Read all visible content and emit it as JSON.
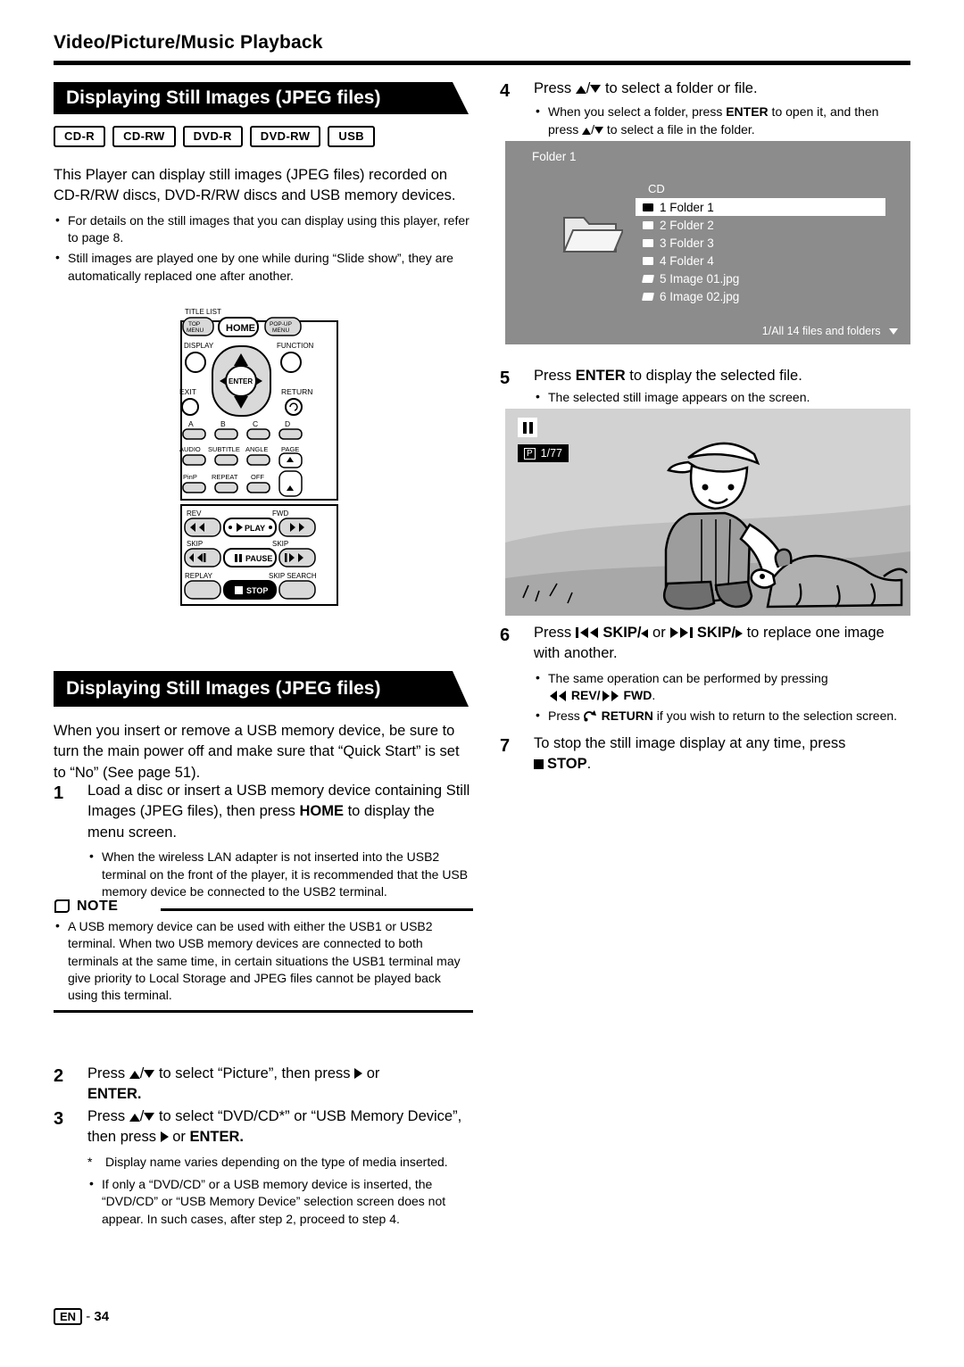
{
  "header": {
    "title": "Video/Picture/Music Playback"
  },
  "banner1": {
    "title": "Displaying Still Images (JPEG files)"
  },
  "chips": [
    "CD-R",
    "CD-RW",
    "DVD-R",
    "DVD-RW",
    "USB"
  ],
  "intro": {
    "paragraph": "This Player can display still images (JPEG files) recorded on CD-R/RW discs, DVD-R/RW discs and USB memory devices.",
    "bullets": [
      "For details on the still images that you can display using this player, refer to page 8.",
      "Still images are played one by one while during “Slide show”, they are automatically replaced one after another."
    ]
  },
  "remote": {
    "labels": {
      "title_list": "TITLE LIST",
      "top_menu": "TOP\nMENU",
      "home": "HOME",
      "popup_menu": "POP-UP\nMENU",
      "display": "DISPLAY",
      "function": "FUNCTION",
      "enter": "ENTER",
      "exit": "EXIT",
      "return": "RETURN",
      "a": "A",
      "b": "B",
      "c": "C",
      "d": "D",
      "audio": "AUDIO",
      "subtitle": "SUBTITLE",
      "angle": "ANGLE",
      "page": "PAGE",
      "pinp": "PinP",
      "repeat": "REPEAT",
      "off": "OFF",
      "rev": "REV",
      "fwd": "FWD",
      "play": "PLAY",
      "skip_l": "SKIP",
      "skip_r": "SKIP",
      "replay": "REPLAY",
      "skip_search": "SKIP SEARCH",
      "pause": "PAUSE",
      "stop": "STOP"
    }
  },
  "banner2": {
    "title": "Displaying Still Images (JPEG files)"
  },
  "usb_note": "When you insert or remove a USB memory device, be sure to turn the main power off and make sure that “Quick Start” is set to “No” (See page 51).",
  "steps_left": [
    {
      "num": "1",
      "text_parts": [
        {
          "t": "Load a disc or insert a USB memory device containing Still Images (JPEG files), then press ",
          "b": false
        },
        {
          "t": "HOME",
          "b": true
        },
        {
          "t": " to display the menu screen.",
          "b": false
        }
      ],
      "bullets": [
        "When the wireless LAN adapter is not inserted into the USB2 terminal on the front of the player, it is recommended that the USB memory device be connected to the USB2 terminal."
      ]
    }
  ],
  "note": {
    "label": "NOTE",
    "bullets": [
      "A USB memory device can be used with either the USB1 or USB2 terminal. When two USB memory devices are connected to both terminals at the same time, in certain situations the USB1 terminal may give priority to Local Storage and JPEG files cannot be played back using this terminal."
    ]
  },
  "steps_left2": [
    {
      "num": "2",
      "pre": "Press ",
      "mid": " to select “Picture”, then press ",
      "post": " or ",
      "bold_end": "ENTER."
    },
    {
      "num": "3",
      "pre": "Press ",
      "mid": " to select “DVD/CD*” or “USB Memory Device”, then press ",
      "post": " or ",
      "bold_end": "ENTER.",
      "star_note": "Display name varies depending on the type of media inserted.",
      "bullets": [
        "If only a “DVD/CD” or a USB memory device is inserted, the “DVD/CD” or “USB Memory Device” selection screen does not appear. In such cases, after step 2, proceed to step 4."
      ]
    }
  ],
  "steps_right": {
    "step4": {
      "num": "4",
      "pre": "Press ",
      "post": " to select a folder or file.",
      "bullet_parts": [
        {
          "t": "When you select a folder, press ",
          "b": false
        },
        {
          "t": "ENTER",
          "b": true
        },
        {
          "t": " to open it, and then press ",
          "b": false
        },
        {
          "t": "ARROWS",
          "b": false
        },
        {
          "t": " to select a file in the folder.",
          "b": false
        }
      ]
    },
    "step5": {
      "num": "5",
      "pre": "Press ",
      "bold": "ENTER",
      "post": " to display the selected file.",
      "bullet": "The selected still image appears on the screen."
    },
    "step6": {
      "num": "6",
      "pre": "Press ",
      "skip_left": "SKIP/",
      "or": " or ",
      "skip_right": "SKIP/",
      "tail": " to replace one image with another.",
      "bullets": [
        {
          "pre": "The same operation can be performed by pressing ",
          "bold": "REV/",
          "bold2": "FWD",
          "post": "."
        },
        {
          "pre": "Press ",
          "bold": "RETURN",
          "post": " if you wish to return to the selection screen."
        }
      ]
    },
    "step7": {
      "num": "7",
      "pre": "To stop the still image display at any time, press ",
      "bold": "STOP",
      "post": "."
    }
  },
  "screen1": {
    "folder_label": "Folder 1",
    "cd_label": "CD",
    "items": [
      {
        "label": "1 Folder 1",
        "selected": true,
        "type": "folder"
      },
      {
        "label": "2 Folder 2",
        "selected": false,
        "type": "folder"
      },
      {
        "label": "3 Folder 3",
        "selected": false,
        "type": "folder"
      },
      {
        "label": "4 Folder 4",
        "selected": false,
        "type": "folder"
      },
      {
        "label": "5 Image 01.jpg",
        "selected": false,
        "type": "image"
      },
      {
        "label": "6 Image 02.jpg",
        "selected": false,
        "type": "image"
      }
    ],
    "footer": "1/All 14 files and folders"
  },
  "screen2": {
    "counter": "1/77",
    "page_icon_label": "P"
  },
  "footer": {
    "lang": "EN",
    "sep": "-",
    "page": "34"
  },
  "colors": {
    "ink": "#000000",
    "screen_gray": "#8c8c8c",
    "photo_bg": "#cfcfcf"
  }
}
